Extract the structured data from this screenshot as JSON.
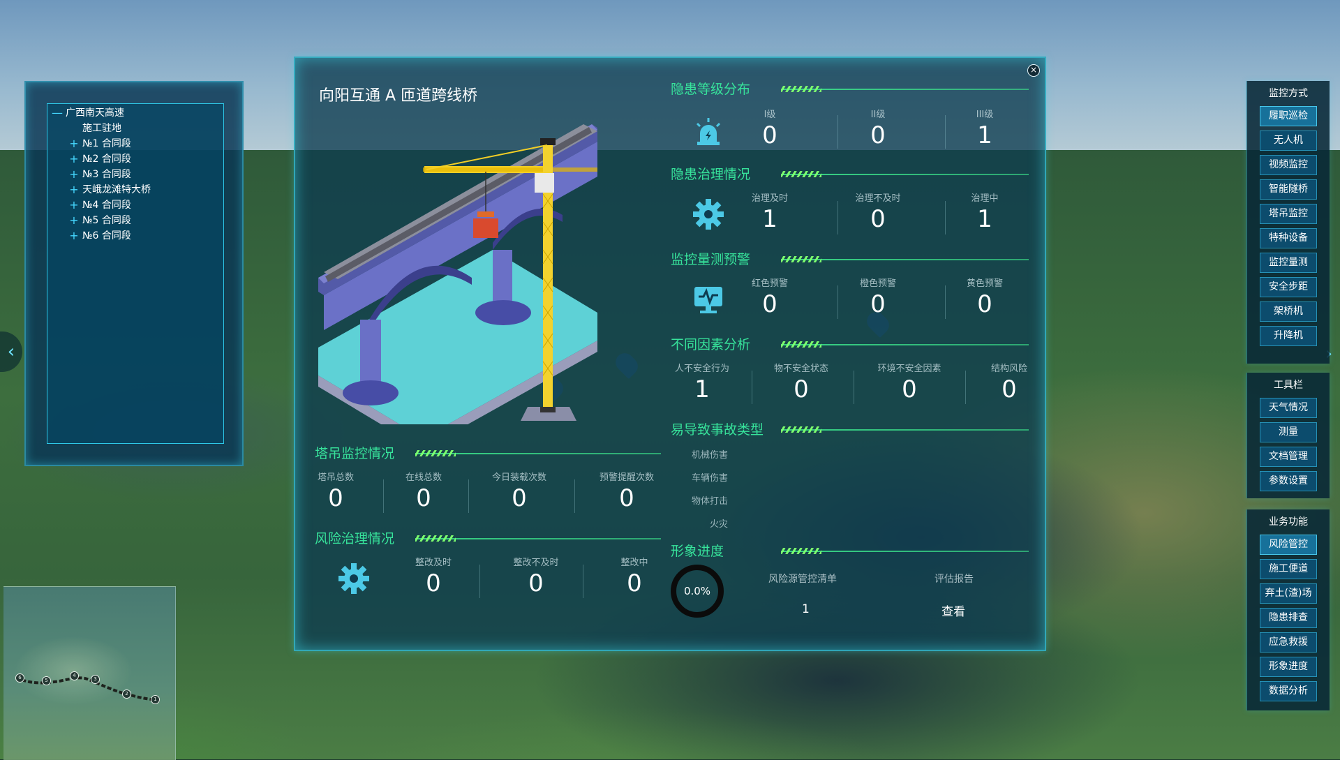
{
  "tree": {
    "root": {
      "symbol": "—",
      "label": "广西南天高速"
    },
    "items": [
      {
        "symbol": "",
        "label": "施工驻地"
      },
      {
        "symbol": "+",
        "label": "№1 合同段"
      },
      {
        "symbol": "+",
        "label": "№2 合同段"
      },
      {
        "symbol": "+",
        "label": "№3 合同段"
      },
      {
        "symbol": "+",
        "label": "天峨龙滩特大桥"
      },
      {
        "symbol": "+",
        "label": "№4 合同段"
      },
      {
        "symbol": "+",
        "label": "№5 合同段"
      },
      {
        "symbol": "+",
        "label": "№6 合同段"
      }
    ]
  },
  "minimap": {
    "nodes": [
      "6",
      "5",
      "4",
      "3",
      "2",
      "1"
    ]
  },
  "nav": {
    "left_arrow": "‹",
    "right_arrow": "›"
  },
  "modal": {
    "close_symbol": "×",
    "title": "向阳互通 A 匝道跨线桥",
    "hazard_level": {
      "title": "隐患等级分布",
      "icon": "alarm-light-icon",
      "metrics": [
        {
          "label": "I级",
          "value": "0"
        },
        {
          "label": "II级",
          "value": "0"
        },
        {
          "label": "III级",
          "value": "1"
        }
      ]
    },
    "hazard_governance": {
      "title": "隐患治理情况",
      "icon": "gear-icon",
      "metrics": [
        {
          "label": "治理及时",
          "value": "1"
        },
        {
          "label": "治理不及时",
          "value": "0"
        },
        {
          "label": "治理中",
          "value": "1"
        }
      ]
    },
    "monitor_warning": {
      "title": "监控量测预警",
      "icon": "monitor-pulse-icon",
      "metrics": [
        {
          "label": "红色预警",
          "value": "0"
        },
        {
          "label": "橙色预警",
          "value": "0"
        },
        {
          "label": "黄色预警",
          "value": "0"
        }
      ]
    },
    "factor_analysis": {
      "title": "不同因素分析",
      "metrics": [
        {
          "label": "人不安全行为",
          "value": "1"
        },
        {
          "label": "物不安全状态",
          "value": "0"
        },
        {
          "label": "环境不安全因素",
          "value": "0"
        },
        {
          "label": "结构风险",
          "value": "0"
        }
      ]
    },
    "accident_types": {
      "title": "易导致事故类型",
      "items": [
        "机械伤害",
        "车辆伤害",
        "物体打击",
        "火灾"
      ]
    },
    "crane_monitor": {
      "title": "塔吊监控情况",
      "metrics": [
        {
          "label": "塔吊总数",
          "value": "0"
        },
        {
          "label": "在线总数",
          "value": "0"
        },
        {
          "label": "今日装载次数",
          "value": "0"
        },
        {
          "label": "预警提醒次数",
          "value": "0"
        }
      ]
    },
    "risk_governance": {
      "title": "风险治理情况",
      "icon": "gear-icon",
      "metrics": [
        {
          "label": "整改及时",
          "value": "0"
        },
        {
          "label": "整改不及时",
          "value": "0"
        },
        {
          "label": "整改中",
          "value": "0"
        }
      ]
    },
    "progress": {
      "title": "形象进度",
      "percent_text": "0.0%",
      "percent": 0,
      "list_label": "风险源管控清单",
      "list_value": "1",
      "report_label": "评估报告",
      "report_link": "查看"
    }
  },
  "right_menu": {
    "monitor": {
      "title": "监控方式",
      "items": [
        "履职巡检",
        "无人机",
        "视频监控",
        "智能隧桥",
        "塔吊监控",
        "特种设备",
        "监控量测",
        "安全步距",
        "架桥机",
        "升降机"
      ],
      "active": "履职巡检"
    },
    "tools": {
      "title": "工具栏",
      "items": [
        "天气情况",
        "测量",
        "文档管理",
        "参数设置"
      ]
    },
    "business": {
      "title": "业务功能",
      "items": [
        "风险管控",
        "施工便道",
        "弃土(渣)场",
        "隐患排查",
        "应急救援",
        "形象进度",
        "数据分析"
      ],
      "active": "风险管控"
    }
  },
  "colors": {
    "accent_green": "#37e39b",
    "panel_border": "#3ac8dc",
    "button_bg": "#0c4c6d"
  }
}
